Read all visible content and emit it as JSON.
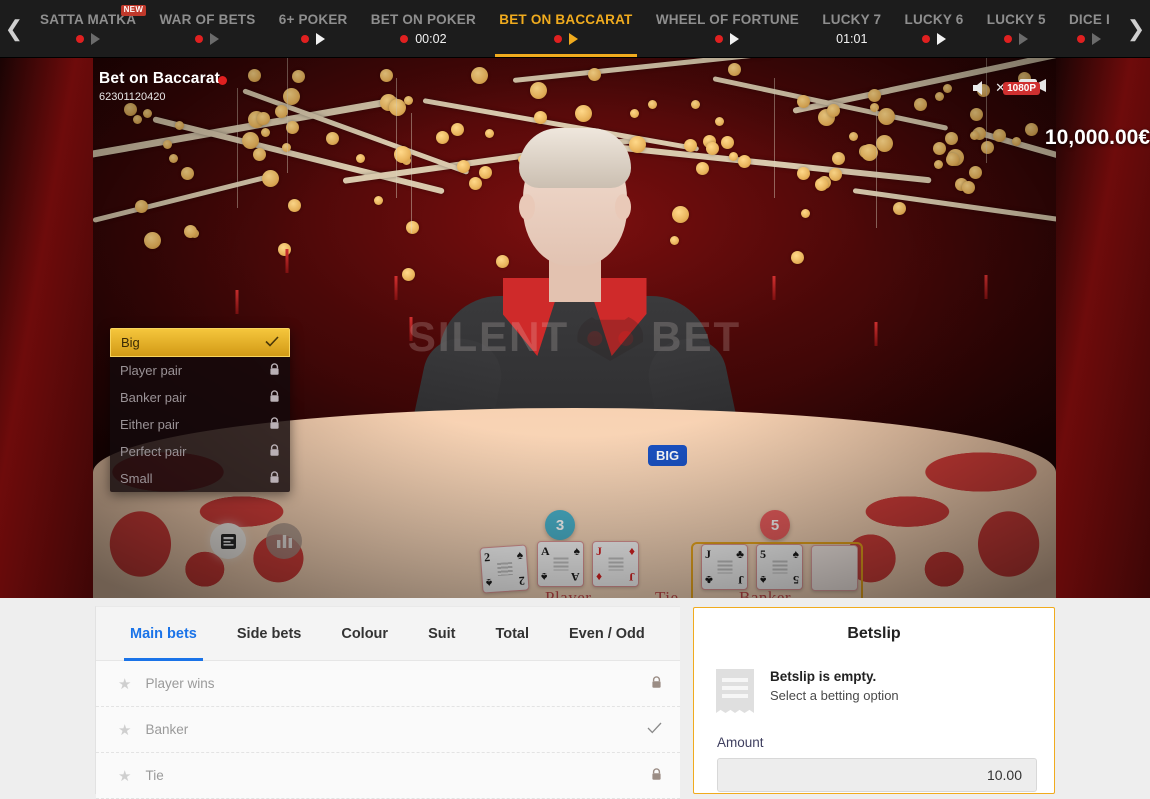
{
  "topnav": {
    "prev_icon": "chevron-left-icon",
    "next_icon": "chevron-right-icon",
    "items": [
      {
        "label": "SATTA MATKA",
        "badge": "NEW",
        "status": "live",
        "play": "dim",
        "time": ""
      },
      {
        "label": "WAR OF BETS",
        "badge": "",
        "status": "live",
        "play": "dim",
        "time": ""
      },
      {
        "label": "6+ POKER",
        "badge": "",
        "status": "live",
        "play": "bright",
        "time": ""
      },
      {
        "label": "BET ON POKER",
        "badge": "",
        "status": "live",
        "play": "none",
        "time": "00:02"
      },
      {
        "label": "BET ON BACCARAT",
        "badge": "",
        "status": "live",
        "play": "gold",
        "time": "",
        "active": true
      },
      {
        "label": "WHEEL OF FORTUNE",
        "badge": "",
        "status": "live",
        "play": "bright",
        "time": ""
      },
      {
        "label": "LUCKY 7",
        "badge": "",
        "status": "none",
        "play": "none",
        "time": "01:01"
      },
      {
        "label": "LUCKY 6",
        "badge": "",
        "status": "live",
        "play": "bright",
        "time": ""
      },
      {
        "label": "LUCKY 5",
        "badge": "",
        "status": "live",
        "play": "dim",
        "time": ""
      },
      {
        "label": "DICE I",
        "badge": "",
        "status": "live",
        "play": "dim",
        "time": ""
      }
    ]
  },
  "video": {
    "game_title": "Bet on Baccarat",
    "round_id": "62301120420",
    "live_indicator": "live-dot",
    "quality_badge": "1080P",
    "mute_icon": "speaker-muted-icon",
    "camera_icon": "video-camera-icon",
    "balance": "10,000.00€",
    "watermark_text_left": "SILENT",
    "watermark_text_right": "BET",
    "watermark_logo": "owl-icon",
    "big_badge": "BIG",
    "rules_button_icon": "rules-list-icon",
    "stats_button_icon": "statistics-bar-icon"
  },
  "dropdown": {
    "items": [
      {
        "label": "Big",
        "state": "selected",
        "icon": "check-icon"
      },
      {
        "label": "Player pair",
        "state": "locked",
        "icon": "lock-icon"
      },
      {
        "label": "Banker pair",
        "state": "locked",
        "icon": "lock-icon"
      },
      {
        "label": "Either pair",
        "state": "locked",
        "icon": "lock-icon"
      },
      {
        "label": "Perfect pair",
        "state": "locked",
        "icon": "lock-icon"
      },
      {
        "label": "Small",
        "state": "locked",
        "icon": "lock-icon"
      }
    ]
  },
  "table": {
    "player_score": "3",
    "banker_score": "5",
    "player_label": "Player",
    "tie_label": "Tie",
    "banker_label": "Banker",
    "player_cards": [
      {
        "rank": "2",
        "suit": "♠",
        "color": "black"
      },
      {
        "rank": "A",
        "suit": "♠",
        "color": "black"
      },
      {
        "rank": "J",
        "suit": "♦",
        "color": "red"
      }
    ],
    "banker_cards": [
      {
        "rank": "J",
        "suit": "♣",
        "color": "black"
      },
      {
        "rank": "5",
        "suit": "♠",
        "color": "black"
      },
      {
        "rank": "",
        "suit": "",
        "color": ""
      }
    ],
    "player_button_icon": "lock-icon",
    "tie_button_icon": "lock-icon",
    "banker_button_icon": "check-icon"
  },
  "bets_panel": {
    "tabs": [
      {
        "label": "Main bets",
        "active": true
      },
      {
        "label": "Side bets",
        "active": false
      },
      {
        "label": "Colour",
        "active": false
      },
      {
        "label": "Suit",
        "active": false
      },
      {
        "label": "Total",
        "active": false
      },
      {
        "label": "Even / Odd",
        "active": false
      }
    ],
    "rows": [
      {
        "name": "Player wins",
        "state": "locked",
        "star_icon": "star-icon",
        "state_icon": "lock-icon"
      },
      {
        "name": "Banker",
        "state": "check",
        "star_icon": "star-icon",
        "state_icon": "check-icon"
      },
      {
        "name": "Tie",
        "state": "locked",
        "star_icon": "star-icon",
        "state_icon": "lock-icon"
      }
    ]
  },
  "betslip": {
    "title": "Betslip",
    "icon": "receipt-icon",
    "empty_title": "Betslip is empty.",
    "empty_subtitle": "Select a betting option",
    "amount_label": "Amount",
    "amount_value": "10.00"
  },
  "colors": {
    "accent_gold": "#f0ab1e",
    "accent_blue": "#1a73e8",
    "live_red": "#e02020",
    "nav_bg": "#1c1c1c",
    "panel_bg": "#eeeeee"
  }
}
